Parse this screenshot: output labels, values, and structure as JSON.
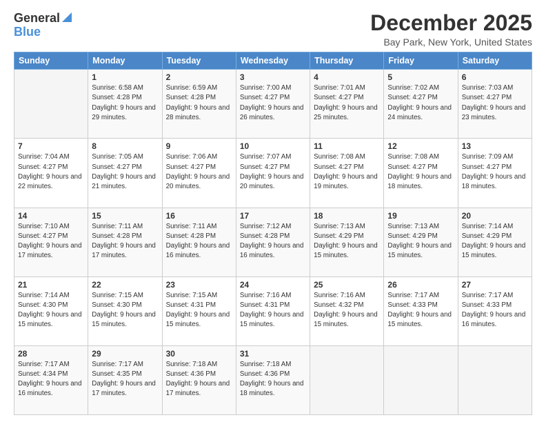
{
  "logo": {
    "general": "General",
    "blue": "Blue"
  },
  "title": "December 2025",
  "subtitle": "Bay Park, New York, United States",
  "days_of_week": [
    "Sunday",
    "Monday",
    "Tuesday",
    "Wednesday",
    "Thursday",
    "Friday",
    "Saturday"
  ],
  "weeks": [
    [
      {
        "date": "",
        "sunrise": "",
        "sunset": "",
        "daylight": ""
      },
      {
        "date": "1",
        "sunrise": "Sunrise: 6:58 AM",
        "sunset": "Sunset: 4:28 PM",
        "daylight": "Daylight: 9 hours and 29 minutes."
      },
      {
        "date": "2",
        "sunrise": "Sunrise: 6:59 AM",
        "sunset": "Sunset: 4:28 PM",
        "daylight": "Daylight: 9 hours and 28 minutes."
      },
      {
        "date": "3",
        "sunrise": "Sunrise: 7:00 AM",
        "sunset": "Sunset: 4:27 PM",
        "daylight": "Daylight: 9 hours and 26 minutes."
      },
      {
        "date": "4",
        "sunrise": "Sunrise: 7:01 AM",
        "sunset": "Sunset: 4:27 PM",
        "daylight": "Daylight: 9 hours and 25 minutes."
      },
      {
        "date": "5",
        "sunrise": "Sunrise: 7:02 AM",
        "sunset": "Sunset: 4:27 PM",
        "daylight": "Daylight: 9 hours and 24 minutes."
      },
      {
        "date": "6",
        "sunrise": "Sunrise: 7:03 AM",
        "sunset": "Sunset: 4:27 PM",
        "daylight": "Daylight: 9 hours and 23 minutes."
      }
    ],
    [
      {
        "date": "7",
        "sunrise": "Sunrise: 7:04 AM",
        "sunset": "Sunset: 4:27 PM",
        "daylight": "Daylight: 9 hours and 22 minutes."
      },
      {
        "date": "8",
        "sunrise": "Sunrise: 7:05 AM",
        "sunset": "Sunset: 4:27 PM",
        "daylight": "Daylight: 9 hours and 21 minutes."
      },
      {
        "date": "9",
        "sunrise": "Sunrise: 7:06 AM",
        "sunset": "Sunset: 4:27 PM",
        "daylight": "Daylight: 9 hours and 20 minutes."
      },
      {
        "date": "10",
        "sunrise": "Sunrise: 7:07 AM",
        "sunset": "Sunset: 4:27 PM",
        "daylight": "Daylight: 9 hours and 20 minutes."
      },
      {
        "date": "11",
        "sunrise": "Sunrise: 7:08 AM",
        "sunset": "Sunset: 4:27 PM",
        "daylight": "Daylight: 9 hours and 19 minutes."
      },
      {
        "date": "12",
        "sunrise": "Sunrise: 7:08 AM",
        "sunset": "Sunset: 4:27 PM",
        "daylight": "Daylight: 9 hours and 18 minutes."
      },
      {
        "date": "13",
        "sunrise": "Sunrise: 7:09 AM",
        "sunset": "Sunset: 4:27 PM",
        "daylight": "Daylight: 9 hours and 18 minutes."
      }
    ],
    [
      {
        "date": "14",
        "sunrise": "Sunrise: 7:10 AM",
        "sunset": "Sunset: 4:27 PM",
        "daylight": "Daylight: 9 hours and 17 minutes."
      },
      {
        "date": "15",
        "sunrise": "Sunrise: 7:11 AM",
        "sunset": "Sunset: 4:28 PM",
        "daylight": "Daylight: 9 hours and 17 minutes."
      },
      {
        "date": "16",
        "sunrise": "Sunrise: 7:11 AM",
        "sunset": "Sunset: 4:28 PM",
        "daylight": "Daylight: 9 hours and 16 minutes."
      },
      {
        "date": "17",
        "sunrise": "Sunrise: 7:12 AM",
        "sunset": "Sunset: 4:28 PM",
        "daylight": "Daylight: 9 hours and 16 minutes."
      },
      {
        "date": "18",
        "sunrise": "Sunrise: 7:13 AM",
        "sunset": "Sunset: 4:29 PM",
        "daylight": "Daylight: 9 hours and 15 minutes."
      },
      {
        "date": "19",
        "sunrise": "Sunrise: 7:13 AM",
        "sunset": "Sunset: 4:29 PM",
        "daylight": "Daylight: 9 hours and 15 minutes."
      },
      {
        "date": "20",
        "sunrise": "Sunrise: 7:14 AM",
        "sunset": "Sunset: 4:29 PM",
        "daylight": "Daylight: 9 hours and 15 minutes."
      }
    ],
    [
      {
        "date": "21",
        "sunrise": "Sunrise: 7:14 AM",
        "sunset": "Sunset: 4:30 PM",
        "daylight": "Daylight: 9 hours and 15 minutes."
      },
      {
        "date": "22",
        "sunrise": "Sunrise: 7:15 AM",
        "sunset": "Sunset: 4:30 PM",
        "daylight": "Daylight: 9 hours and 15 minutes."
      },
      {
        "date": "23",
        "sunrise": "Sunrise: 7:15 AM",
        "sunset": "Sunset: 4:31 PM",
        "daylight": "Daylight: 9 hours and 15 minutes."
      },
      {
        "date": "24",
        "sunrise": "Sunrise: 7:16 AM",
        "sunset": "Sunset: 4:31 PM",
        "daylight": "Daylight: 9 hours and 15 minutes."
      },
      {
        "date": "25",
        "sunrise": "Sunrise: 7:16 AM",
        "sunset": "Sunset: 4:32 PM",
        "daylight": "Daylight: 9 hours and 15 minutes."
      },
      {
        "date": "26",
        "sunrise": "Sunrise: 7:17 AM",
        "sunset": "Sunset: 4:33 PM",
        "daylight": "Daylight: 9 hours and 15 minutes."
      },
      {
        "date": "27",
        "sunrise": "Sunrise: 7:17 AM",
        "sunset": "Sunset: 4:33 PM",
        "daylight": "Daylight: 9 hours and 16 minutes."
      }
    ],
    [
      {
        "date": "28",
        "sunrise": "Sunrise: 7:17 AM",
        "sunset": "Sunset: 4:34 PM",
        "daylight": "Daylight: 9 hours and 16 minutes."
      },
      {
        "date": "29",
        "sunrise": "Sunrise: 7:17 AM",
        "sunset": "Sunset: 4:35 PM",
        "daylight": "Daylight: 9 hours and 17 minutes."
      },
      {
        "date": "30",
        "sunrise": "Sunrise: 7:18 AM",
        "sunset": "Sunset: 4:36 PM",
        "daylight": "Daylight: 9 hours and 17 minutes."
      },
      {
        "date": "31",
        "sunrise": "Sunrise: 7:18 AM",
        "sunset": "Sunset: 4:36 PM",
        "daylight": "Daylight: 9 hours and 18 minutes."
      },
      {
        "date": "",
        "sunrise": "",
        "sunset": "",
        "daylight": ""
      },
      {
        "date": "",
        "sunrise": "",
        "sunset": "",
        "daylight": ""
      },
      {
        "date": "",
        "sunrise": "",
        "sunset": "",
        "daylight": ""
      }
    ]
  ]
}
